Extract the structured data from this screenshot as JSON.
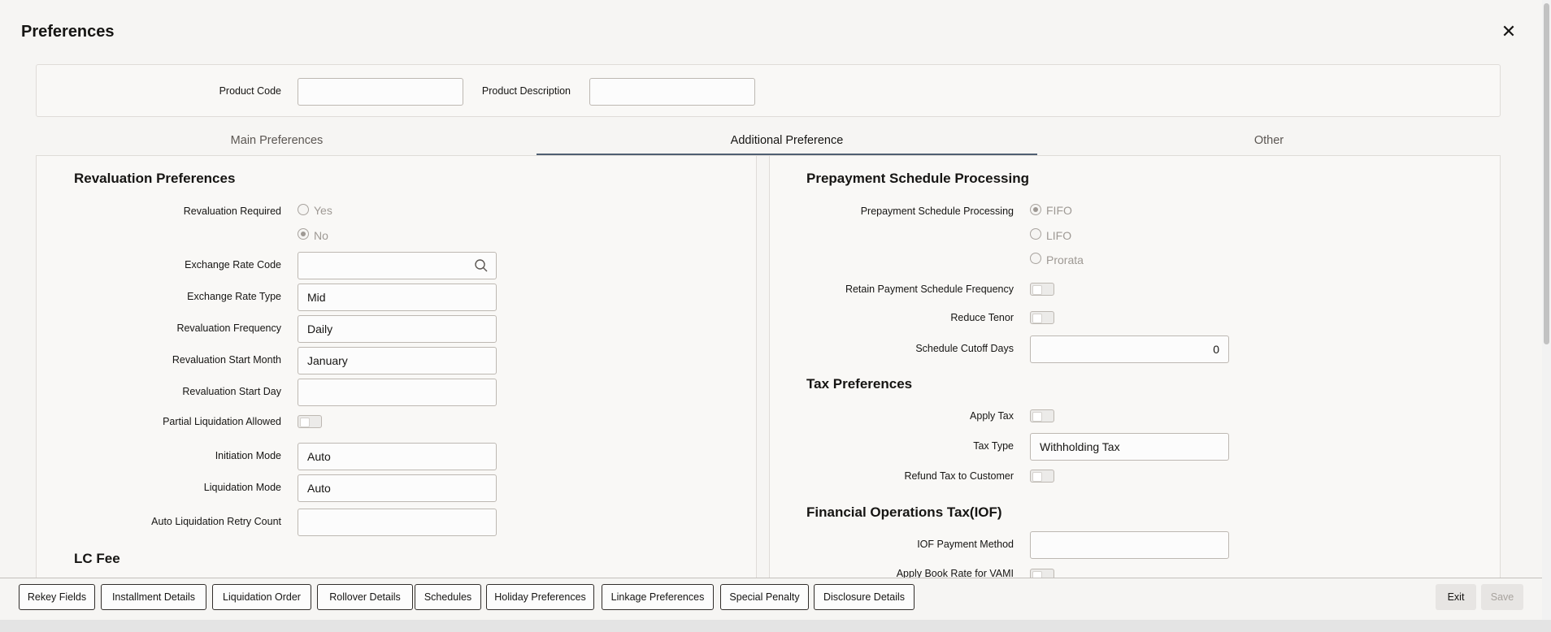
{
  "window": {
    "title": "Preferences"
  },
  "header": {
    "product_code_label": "Product Code",
    "product_code_value": "",
    "product_description_label": "Product Description",
    "product_description_value": ""
  },
  "tabs": [
    {
      "label": "Main Preferences",
      "active": false
    },
    {
      "label": "Additional Preference",
      "active": true
    },
    {
      "label": "Other",
      "active": false
    }
  ],
  "revaluation": {
    "title": "Revaluation Preferences",
    "required_label": "Revaluation Required",
    "options": [
      {
        "label": "Yes",
        "checked": false
      },
      {
        "label": "No",
        "checked": true
      }
    ],
    "exchange_rate_code_label": "Exchange Rate Code",
    "exchange_rate_code_value": "",
    "exchange_rate_type_label": "Exchange Rate Type",
    "exchange_rate_type_value": "Mid",
    "frequency_label": "Revaluation Frequency",
    "frequency_value": "Daily",
    "start_month_label": "Revaluation Start Month",
    "start_month_value": "January",
    "start_day_label": "Revaluation Start Day",
    "start_day_value": "",
    "partial_liquidation_label": "Partial Liquidation Allowed",
    "initiation_mode_label": "Initiation Mode",
    "initiation_mode_value": "Auto",
    "liquidation_mode_label": "Liquidation Mode",
    "liquidation_mode_value": "Auto",
    "retry_count_label": "Auto Liquidation Retry Count",
    "retry_count_value": ""
  },
  "lc_fee": {
    "title": "LC Fee"
  },
  "prepayment": {
    "title": "Prepayment Schedule Processing",
    "processing_label": "Prepayment Schedule Processing",
    "options": [
      {
        "label": "FIFO",
        "checked": true
      },
      {
        "label": "LIFO",
        "checked": false
      },
      {
        "label": "Prorata",
        "checked": false
      }
    ],
    "retain_frequency_label": "Retain Payment Schedule Frequency",
    "reduce_tenor_label": "Reduce Tenor",
    "cutoff_days_label": "Schedule Cutoff Days",
    "cutoff_days_value": "0"
  },
  "tax": {
    "title": "Tax Preferences",
    "apply_tax_label": "Apply Tax",
    "tax_type_label": "Tax Type",
    "tax_type_value": "Withholding Tax",
    "refund_label": "Refund Tax to Customer"
  },
  "iof": {
    "title": "Financial Operations Tax(IOF)",
    "payment_method_label": "IOF Payment Method",
    "payment_method_value": "",
    "book_rate_label": "Apply Book Rate for VAMI"
  },
  "footer": {
    "buttons": [
      "Rekey Fields",
      "Installment Details",
      "Liquidation Order",
      "Rollover Details",
      "Schedules",
      "Holiday Preferences",
      "Linkage Preferences",
      "Special Penalty",
      "Disclosure Details"
    ],
    "exit_label": "Exit",
    "save_label": "Save"
  },
  "icons": {
    "close": "close-icon",
    "search": "search-icon"
  },
  "colors": {
    "active_tab": "#4f5f72",
    "background": "#f6f5f3"
  }
}
